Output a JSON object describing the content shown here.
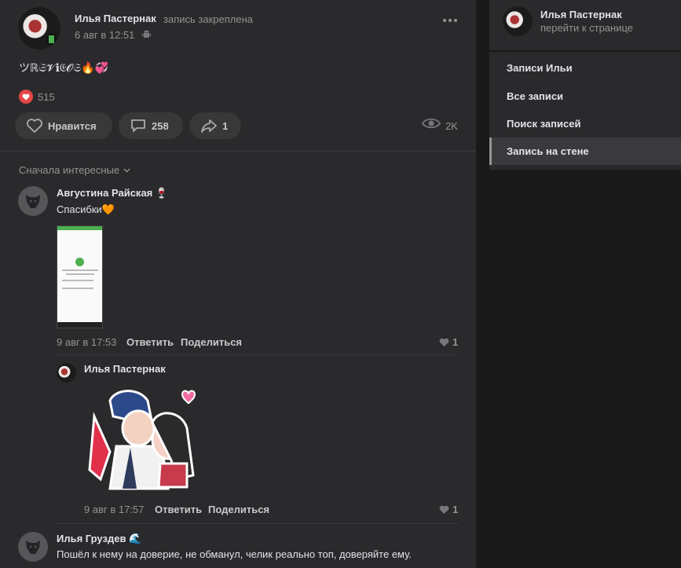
{
  "post": {
    "author": "Илья Пастернак",
    "pinned_label": "запись закреплена",
    "date": "6 авг в 12:51",
    "text": "ツℝ𝔖𝓥ℹ𝔈𝓞𝔖🔥💞",
    "reactions_count": "515",
    "like_label": "Нравится",
    "comments_count": "258",
    "shares_count": "1",
    "views_count": "2K"
  },
  "comments": {
    "sort_label": "Сначала интересные",
    "items": [
      {
        "author": "Августина Райская 🍷",
        "text": "Спасибки🧡",
        "date": "9 авг в 17:53",
        "reply_label": "Ответить",
        "share_label": "Поделиться",
        "likes": "1"
      },
      {
        "author": "Илья Пастернак",
        "date": "9 авг в 17:57",
        "reply_label": "Ответить",
        "share_label": "Поделиться",
        "likes": "1"
      },
      {
        "author": "Илья Груздев 🌊",
        "text": "Пошёл к нему на доверие, не обманул, челик реально топ, доверяйте ему."
      }
    ]
  },
  "sidebar": {
    "name": "Илья Пастернак",
    "link": "перейти к странице",
    "menu": [
      "Записи Ильи",
      "Все записи",
      "Поиск записей",
      "Запись на стене"
    ],
    "active_index": 3
  },
  "icons": {
    "more": "more-icon",
    "android": "android-icon",
    "heart": "heart-icon",
    "comment": "comment-icon",
    "share": "share-icon",
    "views": "eye-icon",
    "chevron": "chevron-down-icon"
  },
  "colors": {
    "panel": "#2a2a2c",
    "background": "#19191a",
    "reaction": "#e64646",
    "text_secondary": "#939393"
  }
}
